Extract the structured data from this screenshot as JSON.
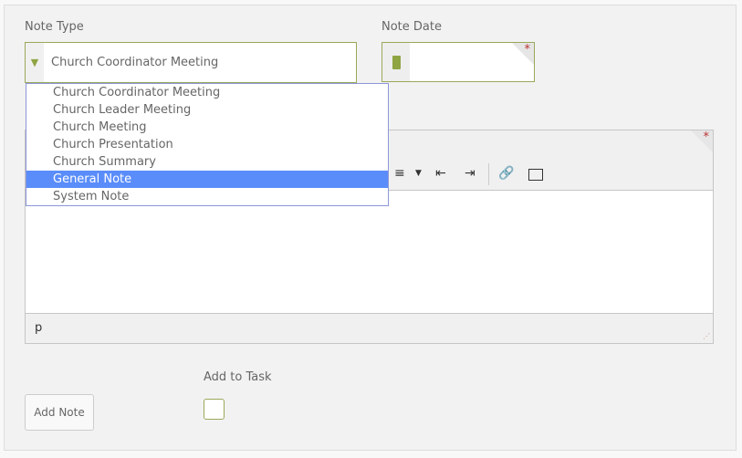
{
  "note_type": {
    "label": "Note Type",
    "selected": "Church Coordinator Meeting",
    "options": [
      "Church Coordinator Meeting",
      "Church Leader Meeting",
      "Church Meeting",
      "Church Presentation",
      "Church Summary",
      "General Note",
      "System Note"
    ],
    "highlighted": "General Note"
  },
  "note_date": {
    "label": "Note Date",
    "value": "",
    "required_mark": "*"
  },
  "editor": {
    "required_mark": "*",
    "status_path": "p",
    "toolbar_icons": [
      "numbered-list-icon",
      "dropdown-caret-icon",
      "outdent-icon",
      "indent-icon",
      "link-icon",
      "image-icon"
    ]
  },
  "add_note": {
    "label": "Add Note"
  },
  "add_to_task": {
    "label": "Add to Task",
    "checked": false
  },
  "colors": {
    "accent": "#9aa85a",
    "highlight": "#5a8dfa",
    "required": "#b33333"
  }
}
